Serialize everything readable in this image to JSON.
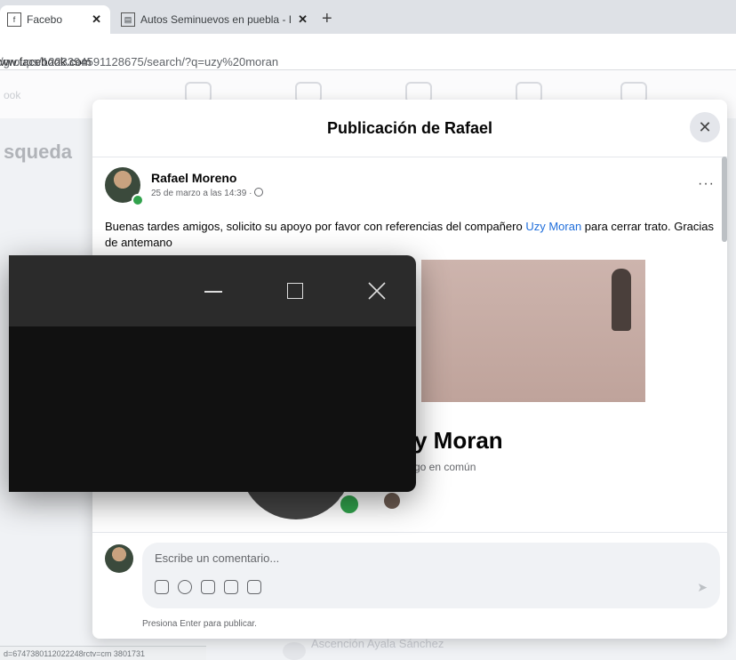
{
  "browser": {
    "tabs": [
      {
        "label": "Facebo",
        "favicon": "f",
        "close": "✕"
      },
      {
        "label": "Autos Seminuevos en puebla - I",
        "favicon": "▤",
        "close": "✕"
      }
    ],
    "new_tab": "+",
    "url_host": "ww.facebook.com",
    "url_path": "/groups/1223394591128675/search/?q=uzy%20moran",
    "status_url": "d=6747380112022248rctv=cm 3801731"
  },
  "background": {
    "brand_fragment": "ook",
    "search_heading": "squeda",
    "ghost_person": "Ascención Ayala Sánchez"
  },
  "modal": {
    "title": "Publicación de Rafael",
    "close_label": "✕",
    "post": {
      "author": "Rafael Moreno",
      "timestamp": "25 de marzo a las 14:39 · ",
      "audience_icon": "globe-icon",
      "more": "···",
      "text_before": "Buenas tardes amigos, solicito su apoyo por favor con referencias del compañero ",
      "mention": "Uzy Moran",
      "text_after": " para cerrar trato. Gracias de antemano"
    },
    "shared_profile": {
      "name_visible": "y Moran",
      "mutual_visible": "go en común"
    },
    "comment": {
      "placeholder": "Escribe un comentario...",
      "tools": [
        "sticker-icon",
        "emoji-icon",
        "camera-icon",
        "gif-icon",
        "avatar-sticker-icon"
      ],
      "send": "➤",
      "hint": "Presiona Enter para publicar."
    }
  },
  "overlay_window": {
    "minimize": "minimize-icon",
    "maximize": "maximize-icon",
    "close_label": "✕"
  },
  "colors": {
    "mention": "#216fdb",
    "online": "#31a24c",
    "window_titlebar": "#2b2b2b",
    "window_body": "#111111"
  }
}
